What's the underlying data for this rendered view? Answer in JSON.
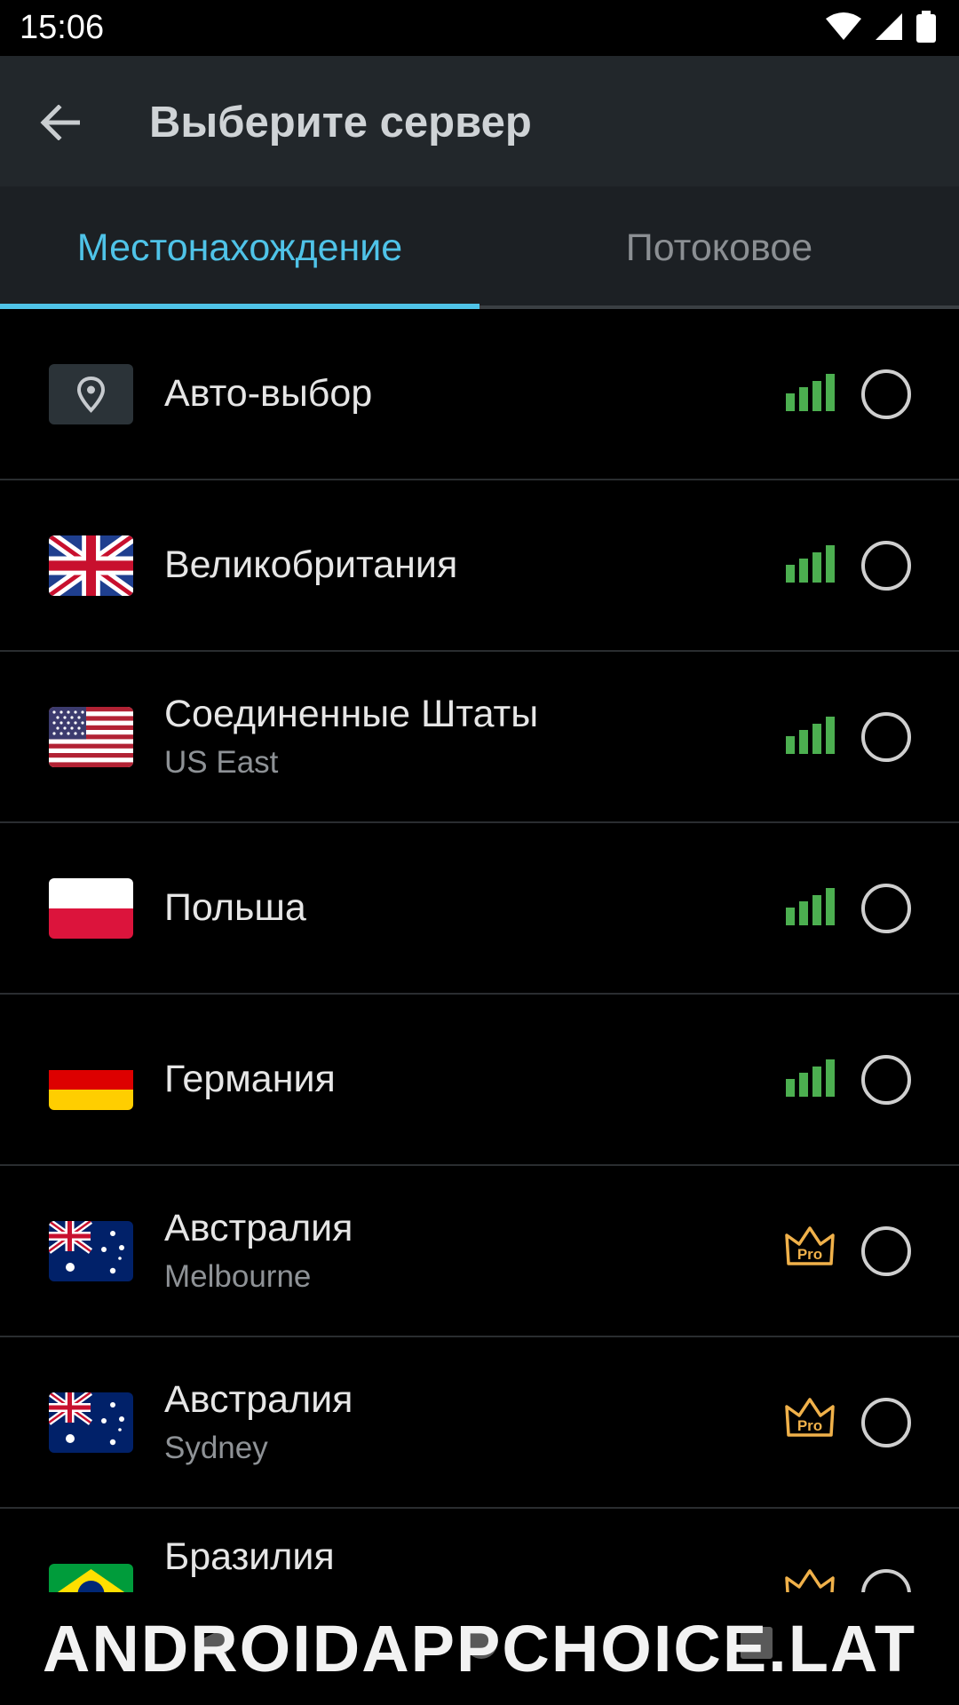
{
  "status": {
    "time": "15:06"
  },
  "header": {
    "title": "Выберите сервер"
  },
  "tabs": [
    {
      "label": "Местонахождение",
      "active": true
    },
    {
      "label": "Потоковое",
      "active": false
    }
  ],
  "colors": {
    "accent": "#4fc3e8",
    "signal_green": "#4caf50",
    "pro_gold": "#f0b14a"
  },
  "servers": [
    {
      "name": "Авто-выбор",
      "subtitle": "",
      "flag": "auto",
      "badge": "signal-icon"
    },
    {
      "name": "Великобритания",
      "subtitle": "",
      "flag": "uk",
      "badge": "signal-icon"
    },
    {
      "name": "Соединенные Штаты",
      "subtitle": "US East",
      "flag": "us",
      "badge": "signal-icon"
    },
    {
      "name": "Польша",
      "subtitle": "",
      "flag": "pl",
      "badge": "signal-icon"
    },
    {
      "name": "Германия",
      "subtitle": "",
      "flag": "de",
      "badge": "signal-icon"
    },
    {
      "name": "Австралия",
      "subtitle": "Melbourne",
      "flag": "au",
      "badge": "pro-crown-icon",
      "badge_text": "Pro"
    },
    {
      "name": "Австралия",
      "subtitle": "Sydney",
      "flag": "au",
      "badge": "pro-crown-icon",
      "badge_text": "Pro"
    },
    {
      "name": "Бразилия",
      "subtitle": "",
      "flag": "br",
      "badge": "pro-crown-icon"
    }
  ],
  "watermark": "ANDROIDAPPCHOICE.LAT"
}
